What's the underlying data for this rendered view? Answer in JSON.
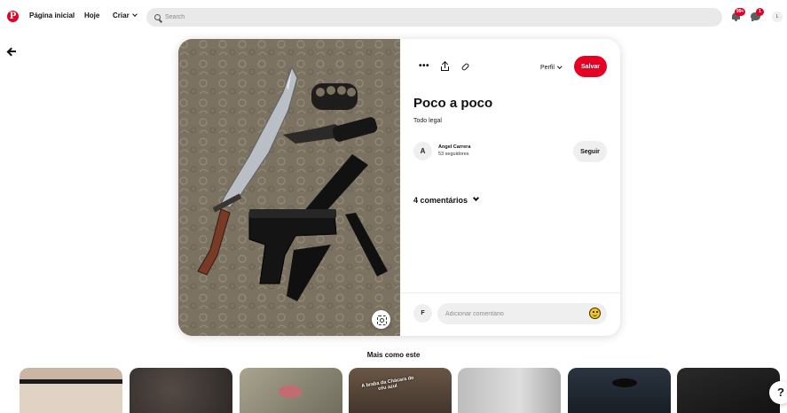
{
  "nav": {
    "logo": "P",
    "home": "Página inicial",
    "today": "Hoje",
    "create": "Criar",
    "search_placeholder": "Search",
    "notification_badge": "99+",
    "message_badge": "1",
    "user_initial": "L"
  },
  "pin": {
    "profile_select": "Perfil",
    "save_label": "Salvar",
    "title": "Poco a poco",
    "description": "Todo legal",
    "author": {
      "initial": "A",
      "name": "Angel Carrera",
      "followers": "53 seguidores"
    },
    "follow_label": "Seguir",
    "comments_label": "4 comentários",
    "commenter_initial": "F",
    "comment_placeholder": "Adicionar comentário"
  },
  "more": {
    "heading": "Mais como este",
    "thumbs": [
      {
        "color": "#c8b5a4"
      },
      {
        "color": "#3a3431"
      },
      {
        "color": "#8f8b78"
      },
      {
        "color": "#5a4a3c",
        "caption_line1": "A braba da Chácara do",
        "caption_line2": "céu azul"
      },
      {
        "color": "#c9c9c9"
      },
      {
        "color": "#1e2630"
      },
      {
        "color": "#1b1b1b"
      }
    ]
  },
  "help_label": "?",
  "colors": {
    "brand": "#e60023",
    "search_bg": "#e9e9e9",
    "button_gray": "#efefef"
  }
}
